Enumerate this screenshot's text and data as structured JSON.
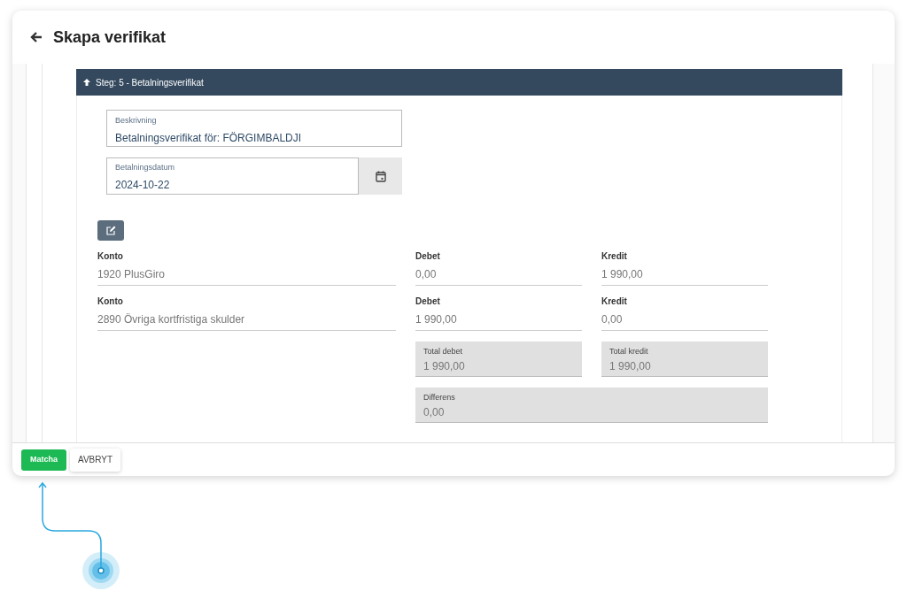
{
  "header": {
    "title": "Skapa verifikat"
  },
  "step": {
    "label": "Steg: 5 - Betalningsverifikat",
    "expanded": true
  },
  "description": {
    "label": "Beskrivning",
    "value": "Betalningsverifikat för: FÖRGIMBALDJI"
  },
  "date": {
    "label": "Betalningsdatum",
    "value": "2024-10-22"
  },
  "lines": [
    {
      "konto_label": "Konto",
      "konto": "1920 PlusGiro",
      "debet_label": "Debet",
      "debet": "0,00",
      "kredit_label": "Kredit",
      "kredit": "1 990,00"
    },
    {
      "konto_label": "Konto",
      "konto": "2890 Övriga kortfristiga skulder",
      "debet_label": "Debet",
      "debet": "1 990,00",
      "kredit_label": "Kredit",
      "kredit": "0,00"
    }
  ],
  "totals": {
    "debet_label": "Total debet",
    "debet": "1 990,00",
    "kredit_label": "Total kredit",
    "kredit": "1 990,00",
    "diff_label": "Differens",
    "diff": "0,00"
  },
  "buttons": [
    {
      "label": "Matcha",
      "kind": "primary"
    },
    {
      "label": "AVBRYT",
      "kind": "secondary"
    }
  ]
}
